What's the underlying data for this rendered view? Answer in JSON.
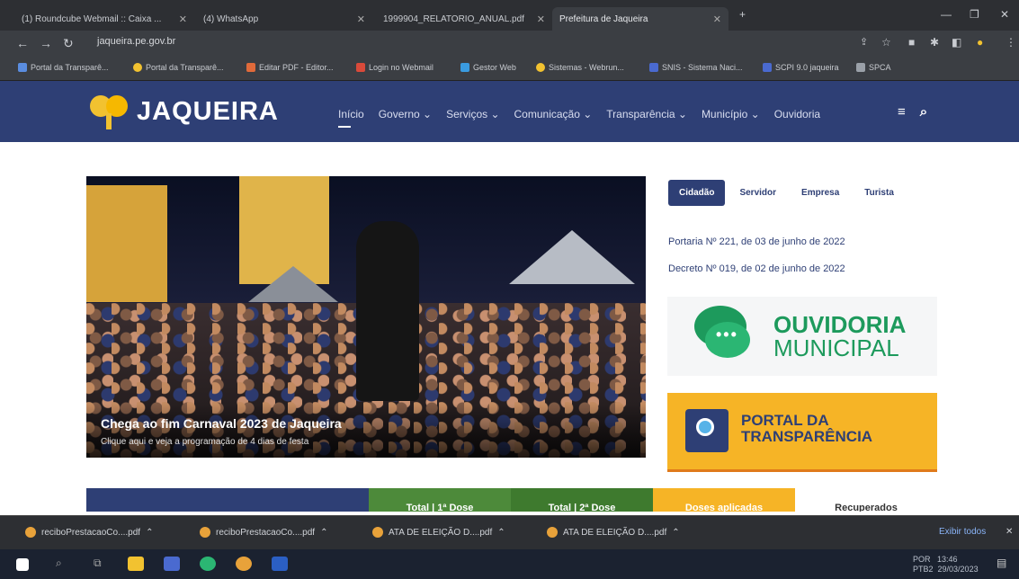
{
  "browser": {
    "tabs": [
      {
        "label": "(1) Roundcube Webmail :: Caixa ..."
      },
      {
        "label": "(4) WhatsApp"
      },
      {
        "label": "1999904_RELATORIO_ANUAL.pdf"
      },
      {
        "label": "Prefeitura de Jaqueira"
      }
    ],
    "url": "jaqueira.pe.gov.br",
    "bookmarks": [
      {
        "label": "Portal da Transparê..."
      },
      {
        "label": "Portal da Transparê..."
      },
      {
        "label": "Editar PDF - Editor..."
      },
      {
        "label": "Login no Webmail"
      },
      {
        "label": "Gestor Web"
      },
      {
        "label": "Sistemas - Webrun..."
      },
      {
        "label": "SNIS - Sistema Naci..."
      },
      {
        "label": "SCPI 9.0 jaqueira"
      },
      {
        "label": "SPCA"
      }
    ]
  },
  "site": {
    "logo_text": "JAQUEIRA",
    "menu": [
      {
        "label": "Início"
      },
      {
        "label": "Governo ⌄"
      },
      {
        "label": "Serviços ⌄"
      },
      {
        "label": "Comunicação ⌄"
      },
      {
        "label": "Transparência ⌄"
      },
      {
        "label": "Município ⌄"
      },
      {
        "label": "Ouvidoria"
      }
    ],
    "hero": {
      "title": "Chega ao fim Carnaval 2023 de Jaqueira",
      "subtitle": "Clique aqui e veja a programação de 4 dias de festa"
    },
    "audience_tabs": [
      {
        "label": "Cidadão"
      },
      {
        "label": "Servidor"
      },
      {
        "label": "Empresa"
      },
      {
        "label": "Turista"
      }
    ],
    "links": [
      {
        "label": "Portaria Nº 221, de 03 de junho de 2022"
      },
      {
        "label": "Decreto Nº 019, de 02 de junho de 2022"
      }
    ],
    "ouvidoria": {
      "title": "OUVIDORIA",
      "subtitle": "MUNICIPAL"
    },
    "transparencia": {
      "line1": "PORTAL DA",
      "line2": "TRANSPARÊNCIA"
    },
    "strip": [
      {
        "label": ""
      },
      {
        "label": "Total | 1ª Dose"
      },
      {
        "label": "Total | 2ª Dose"
      },
      {
        "label": "Doses aplicadas"
      },
      {
        "label": "Recuperados"
      }
    ]
  },
  "downloads": {
    "items": [
      {
        "label": "reciboPrestacaoCo....pdf"
      },
      {
        "label": "reciboPrestacaoCo....pdf"
      },
      {
        "label": "ATA DE ELEIÇÃO D....pdf"
      },
      {
        "label": "ATA DE ELEIÇÃO D....pdf"
      }
    ],
    "show_all": "Exibir todos"
  },
  "taskbar": {
    "lang": "POR",
    "lang2": "PTB2",
    "time": "13:46",
    "date": "29/03/2023"
  }
}
